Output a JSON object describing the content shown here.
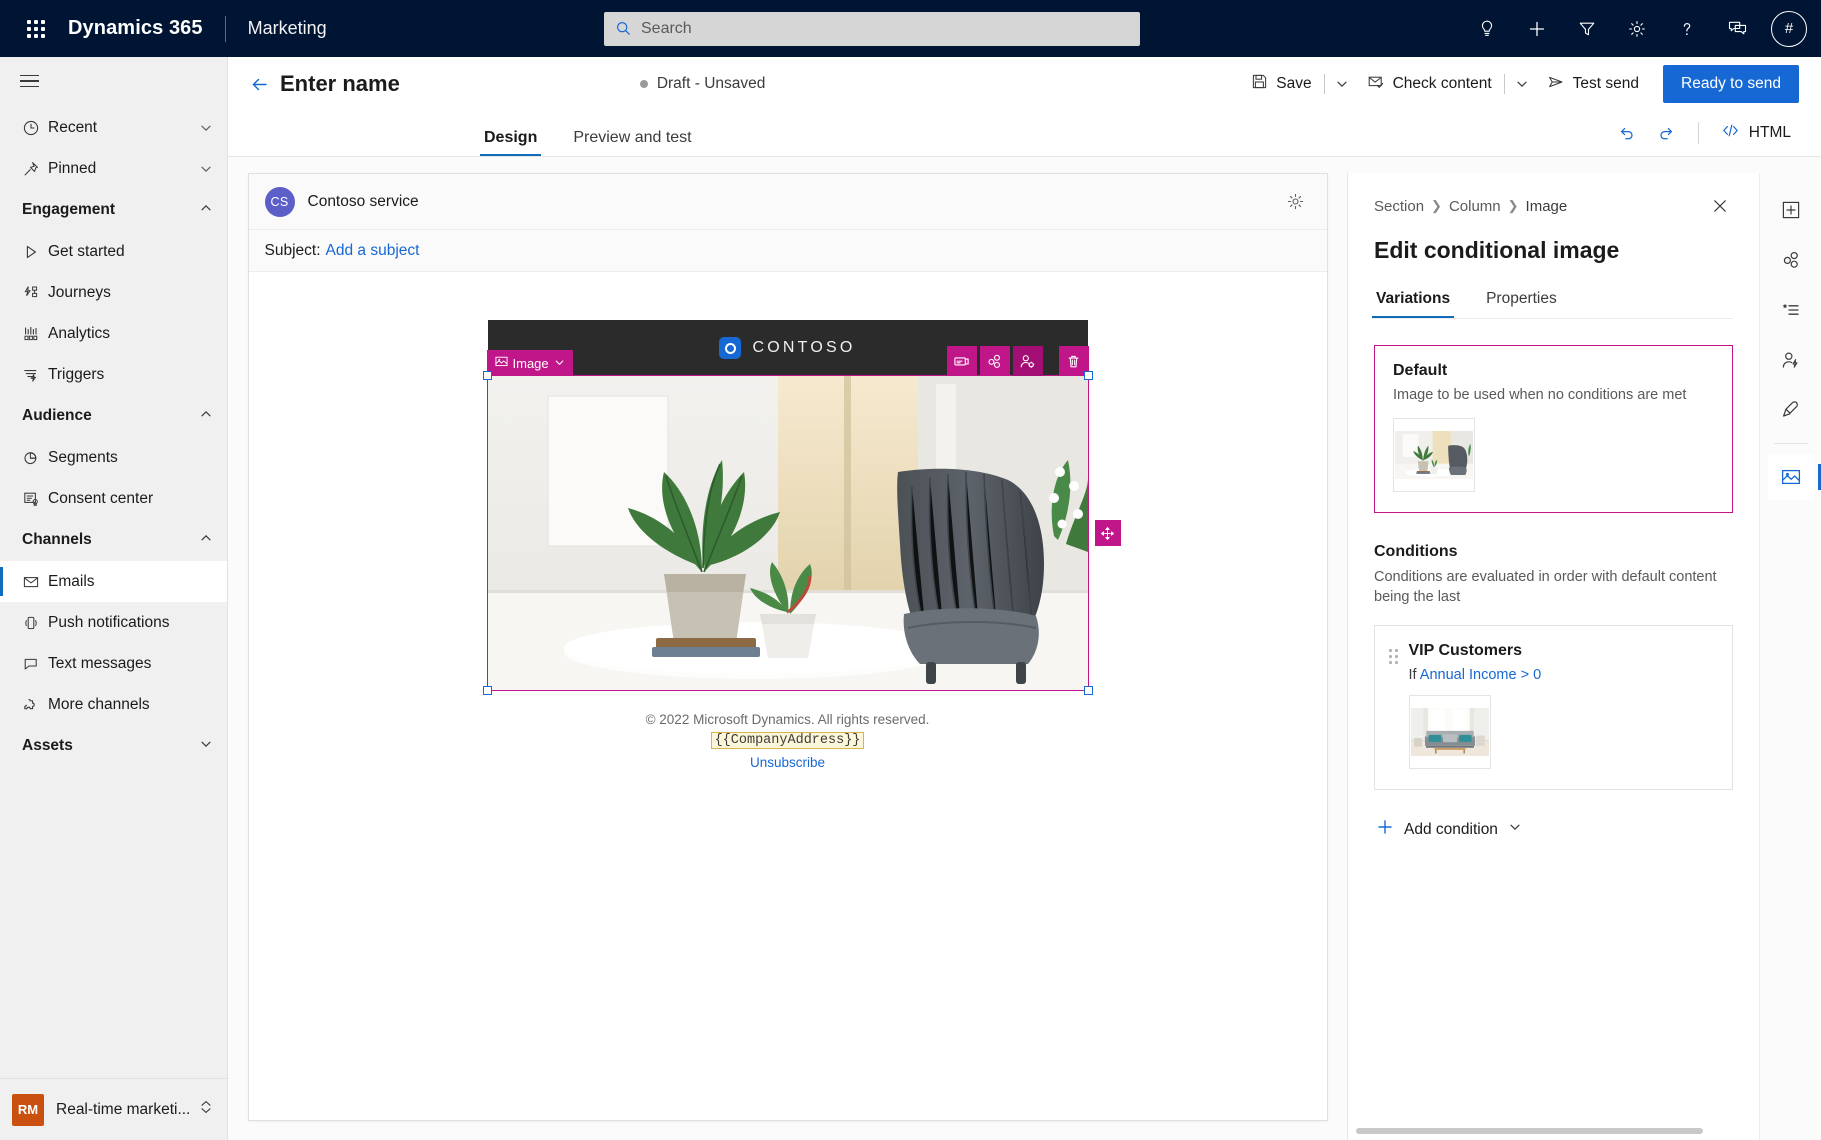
{
  "topnav": {
    "waffle_icon": "app-launcher-icon",
    "brand": "Dynamics 365",
    "app_name": "Marketing",
    "search_placeholder": "Search",
    "search_icon": "search-icon",
    "icons": [
      {
        "name": "lightbulb-icon",
        "label": "Insights"
      },
      {
        "name": "plus-icon",
        "label": "Quick create"
      },
      {
        "name": "filter-icon",
        "label": "Filter"
      },
      {
        "name": "gear-icon",
        "label": "Settings"
      },
      {
        "name": "help-icon",
        "label": "Help"
      },
      {
        "name": "feedback-icon",
        "label": "Feedback"
      }
    ],
    "avatar_initials": "#"
  },
  "sidebar": {
    "hamburger_icon": "hamburger-icon",
    "quick": [
      {
        "label": "Recent",
        "icon": "clock-icon"
      },
      {
        "label": "Pinned",
        "icon": "pin-icon"
      }
    ],
    "groups": [
      {
        "label": "Engagement",
        "items": [
          {
            "label": "Get started",
            "icon": "play-icon"
          },
          {
            "label": "Journeys",
            "icon": "journeys-icon"
          },
          {
            "label": "Analytics",
            "icon": "analytics-icon"
          },
          {
            "label": "Triggers",
            "icon": "triggers-icon"
          }
        ]
      },
      {
        "label": "Audience",
        "items": [
          {
            "label": "Segments",
            "icon": "segments-icon"
          },
          {
            "label": "Consent center",
            "icon": "consent-icon"
          }
        ]
      },
      {
        "label": "Channels",
        "items": [
          {
            "label": "Emails",
            "icon": "envelope-icon",
            "active": true
          },
          {
            "label": "Push notifications",
            "icon": "phone-icon"
          },
          {
            "label": "Text messages",
            "icon": "sms-icon"
          },
          {
            "label": "More channels",
            "icon": "puzzle-icon"
          }
        ]
      },
      {
        "label": "Assets",
        "items": []
      }
    ],
    "area_switcher": {
      "badge": "RM",
      "label": "Real-time marketi..."
    }
  },
  "command_bar": {
    "back_icon": "back-arrow-icon",
    "record_title": "Enter name",
    "status": "Draft - Unsaved",
    "save_label": "Save",
    "save_icon": "save-icon",
    "check_content_label": "Check content",
    "check_content_icon": "check-content-icon",
    "test_send_label": "Test send",
    "test_send_icon": "send-icon",
    "primary_label": "Ready to send"
  },
  "tabs": {
    "items": [
      {
        "label": "Design",
        "active": true
      },
      {
        "label": "Preview and test",
        "active": false
      }
    ],
    "undo_icon": "undo-icon",
    "redo_icon": "redo-icon",
    "html_label": "HTML",
    "html_icon": "code-icon"
  },
  "email": {
    "from_initials": "CS",
    "from_name": "Contoso service",
    "settings_icon": "gear-icon",
    "subject_label": "Subject:",
    "subject_link": "Add a subject",
    "logo_text": "CONTOSO",
    "block": {
      "label": "Image",
      "label_icon": "image-icon",
      "caret_icon": "chevron-down-icon",
      "tools": [
        {
          "name": "layout-icon",
          "label": "Layout"
        },
        {
          "name": "variations-icon",
          "label": "Variations"
        },
        {
          "name": "personalization-icon",
          "label": "Personalize"
        },
        {
          "name": "delete-icon",
          "label": "Delete"
        }
      ],
      "drag_icon": "move-icon"
    },
    "footer": {
      "copyright": "© 2022 Microsoft Dynamics. All rights reserved.",
      "token": "{{CompanyAddress}}",
      "unsubscribe": "Unsubscribe"
    }
  },
  "right_panel": {
    "breadcrumb": [
      "Section",
      "Column",
      "Image"
    ],
    "close_icon": "close-icon",
    "title": "Edit conditional image",
    "tabs": [
      {
        "label": "Variations",
        "active": true
      },
      {
        "label": "Properties",
        "active": false
      }
    ],
    "default_variation": {
      "title": "Default",
      "description": "Image to be used when no conditions are met",
      "thumbnail": "chair-and-plants-thumbnail"
    },
    "conditions_heading": "Conditions",
    "conditions_description": "Conditions are evaluated in order with default content being the last",
    "conditions": [
      {
        "title": "VIP Customers",
        "if_label": "If",
        "field": "Annual Income",
        "operator": ">",
        "value": "0",
        "thumbnail": "living-room-sofa-thumbnail"
      }
    ],
    "add_condition_label": "Add condition",
    "add_icon": "plus-icon",
    "add_caret_icon": "chevron-down-icon"
  },
  "right_rail": {
    "items": [
      {
        "name": "add-element-icon",
        "label": "Elements"
      },
      {
        "name": "variations-icon",
        "label": "Variations"
      },
      {
        "name": "content-blocks-icon",
        "label": "Content blocks"
      },
      {
        "name": "personalization-icon",
        "label": "Personalization"
      },
      {
        "name": "styles-icon",
        "label": "Styles"
      },
      {
        "name": "image-icon",
        "label": "Image",
        "active": true
      }
    ]
  },
  "colors": {
    "nav_bg": "#001433",
    "accent": "#1668d4",
    "selection": "#c0168a",
    "tab_underline": "#0f6cbd",
    "rm_badge": "#ca5010",
    "token_bg": "#fdf6d8"
  }
}
